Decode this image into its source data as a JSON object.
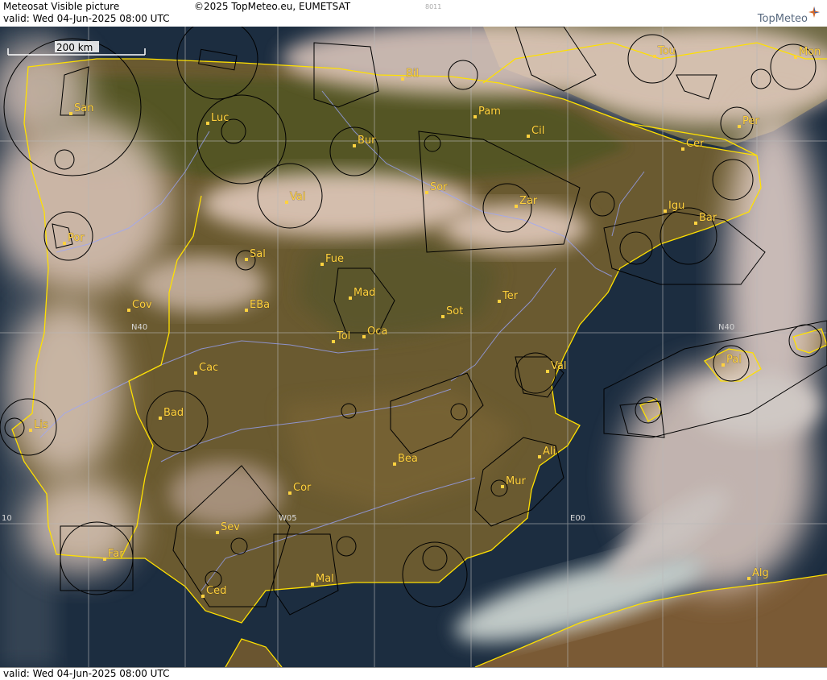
{
  "header": {
    "product": "Meteosat Visible picture",
    "copyright": "©2025 TopMeteo.eu, EUMETSAT",
    "valid": "valid:  Wed  04-Jun-2025  08:00 UTC",
    "code": "8011",
    "logo": "TopMeteo"
  },
  "footer": {
    "valid": "valid:  Wed  04-Jun-2025  08:00 UTC"
  },
  "scale": {
    "label": "200 km"
  },
  "grid_labels": {
    "n40_west": "N40",
    "n40_east": "N40",
    "w05": "W05",
    "e00": "E00",
    "w10": "10"
  },
  "cities": [
    {
      "id": "bil",
      "name": "Bil"
    },
    {
      "id": "san",
      "name": "San"
    },
    {
      "id": "luc",
      "name": "Luc"
    },
    {
      "id": "bur",
      "name": "Bur"
    },
    {
      "id": "pam",
      "name": "Pam"
    },
    {
      "id": "cil",
      "name": "Cil"
    },
    {
      "id": "tou",
      "name": "Tou"
    },
    {
      "id": "mon",
      "name": "Mon"
    },
    {
      "id": "per",
      "name": "Per"
    },
    {
      "id": "cer",
      "name": "Cer"
    },
    {
      "id": "val_north",
      "name": "Val"
    },
    {
      "id": "sor",
      "name": "Sor"
    },
    {
      "id": "zar",
      "name": "Zar"
    },
    {
      "id": "igu",
      "name": "Igu"
    },
    {
      "id": "bar",
      "name": "Bar"
    },
    {
      "id": "por",
      "name": "Por"
    },
    {
      "id": "sal",
      "name": "Sal"
    },
    {
      "id": "fue",
      "name": "Fue"
    },
    {
      "id": "mad",
      "name": "Mad"
    },
    {
      "id": "cov",
      "name": "Cov"
    },
    {
      "id": "eba",
      "name": "EBa"
    },
    {
      "id": "tol",
      "name": "Tol"
    },
    {
      "id": "oca",
      "name": "Oca"
    },
    {
      "id": "sot",
      "name": "Sot"
    },
    {
      "id": "ter",
      "name": "Ter"
    },
    {
      "id": "cac",
      "name": "Cac"
    },
    {
      "id": "val_east",
      "name": "Val"
    },
    {
      "id": "pal",
      "name": "Pal"
    },
    {
      "id": "bad",
      "name": "Bad"
    },
    {
      "id": "lis",
      "name": "Lis"
    },
    {
      "id": "bea",
      "name": "Bea"
    },
    {
      "id": "ali",
      "name": "Ali"
    },
    {
      "id": "mur",
      "name": "Mur"
    },
    {
      "id": "cor",
      "name": "Cor"
    },
    {
      "id": "sev",
      "name": "Sev"
    },
    {
      "id": "far",
      "name": "Far"
    },
    {
      "id": "mal",
      "name": "Mal"
    },
    {
      "id": "ced",
      "name": "Ced"
    },
    {
      "id": "alg",
      "name": "Alg"
    }
  ],
  "colors": {
    "label": "#ffd23f",
    "border": "#ffe000",
    "river": "#9aa6ff",
    "airspace": "#000000",
    "grid": "#b8b8b8",
    "sea": "#1b2c3f",
    "land": "#6b5a2e",
    "cloud": "#e8ccc0"
  }
}
